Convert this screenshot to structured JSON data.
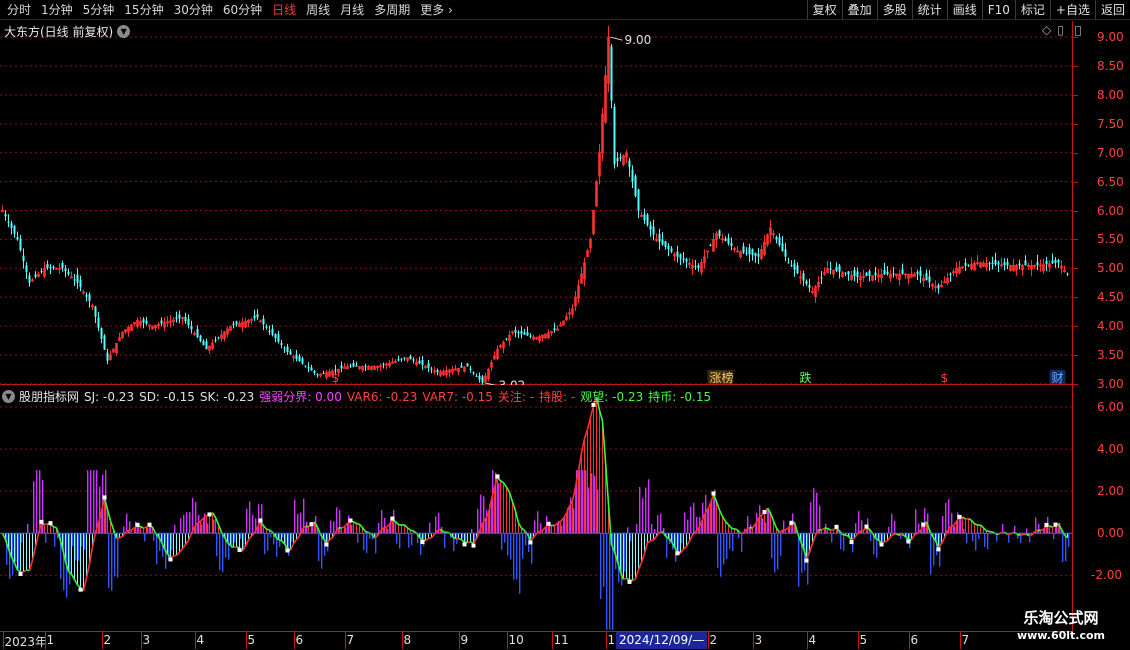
{
  "toolbar": {
    "periods": [
      "分时",
      "1分钟",
      "5分钟",
      "15分钟",
      "30分钟",
      "60分钟",
      "日线",
      "周线",
      "月线",
      "多周期",
      "更多"
    ],
    "active_period": "日线",
    "tools": [
      "复权",
      "叠加",
      "多股",
      "统计",
      "画线",
      "F10",
      "标记",
      "+自选",
      "返回"
    ]
  },
  "main_chart": {
    "title": "大东方(日线 前复权)",
    "corner_icons": [
      "diamond-icon",
      "square-icon"
    ],
    "high_label": "9.00",
    "low_label": "3.02",
    "y_ticks": [
      9.0,
      8.5,
      8.0,
      7.5,
      7.0,
      6.5,
      6.0,
      5.5,
      5.0,
      4.5,
      4.0,
      3.5,
      3.0
    ],
    "y_range": [
      2.98,
      9.28
    ],
    "colors": {
      "up": "#ff3030",
      "down": "#54ffff",
      "grid": "#8b1010"
    },
    "markers": [
      {
        "id": "dollar-1",
        "text": "$",
        "color": "#ff4040",
        "slot": 113
      },
      {
        "id": "zhangbang",
        "text": "涨榜",
        "color": "#ffcc66",
        "slot": 239
      },
      {
        "id": "die",
        "text": "跌",
        "color": "#66ff66",
        "slot": 269
      },
      {
        "id": "dollar-2",
        "text": "$",
        "color": "#ff4040",
        "slot": 316
      },
      {
        "id": "cai",
        "text": "财",
        "color": "#66aaff",
        "slot": 353
      }
    ]
  },
  "indicator": {
    "name": "股朋指标网",
    "values": [
      {
        "label": "SJ: -0.23",
        "color": "#e0e0e0"
      },
      {
        "label": "SD: -0.15",
        "color": "#e0e0e0"
      },
      {
        "label": "SK: -0.23",
        "color": "#e0e0e0"
      },
      {
        "label": "强弱分界: 0.00",
        "color": "#ff44ff"
      },
      {
        "label": "VAR6: -0.23",
        "color": "#ff4040"
      },
      {
        "label": "VAR7: -0.15",
        "color": "#ff4040"
      },
      {
        "label": "关注: -",
        "color": "#ff4040"
      },
      {
        "label": "持股: -",
        "color": "#ff4040"
      },
      {
        "label": "观望: -0.23",
        "color": "#44ff44"
      },
      {
        "label": "持币: -0.15",
        "color": "#44ff44"
      }
    ],
    "y_ticks": [
      6.0,
      4.0,
      2.0,
      0.0,
      -2.0
    ],
    "y_range": [
      -4.6,
      7.0
    ]
  },
  "date_axis": {
    "labels": [
      {
        "text": "2023年",
        "slot": 0
      },
      {
        "text": "1",
        "slot": 14
      },
      {
        "text": "2",
        "slot": 33
      },
      {
        "text": "3",
        "slot": 46
      },
      {
        "text": "4",
        "slot": 64
      },
      {
        "text": "5",
        "slot": 81
      },
      {
        "text": "6",
        "slot": 97
      },
      {
        "text": "7",
        "slot": 114
      },
      {
        "text": "8",
        "slot": 133
      },
      {
        "text": "9",
        "slot": 152
      },
      {
        "text": "10",
        "slot": 168
      },
      {
        "text": "11",
        "slot": 183
      },
      {
        "text": "12",
        "slot": 201
      },
      {
        "text": "2",
        "slot": 235
      },
      {
        "text": "3",
        "slot": 250
      },
      {
        "text": "4",
        "slot": 268
      },
      {
        "text": "5",
        "slot": 285
      },
      {
        "text": "6",
        "slot": 302
      },
      {
        "text": "7",
        "slot": 319
      }
    ],
    "cursor_date": "2024/12/09/—"
  },
  "watermark": {
    "title": "乐淘公式网",
    "url": "www.60lt.com"
  },
  "chart_data": {
    "type": "candlestick",
    "price_anchors": [
      [
        0,
        6.0
      ],
      [
        5,
        5.5
      ],
      [
        9,
        4.75
      ],
      [
        14,
        5.0
      ],
      [
        20,
        5.0
      ],
      [
        25,
        4.75
      ],
      [
        30,
        4.35
      ],
      [
        35,
        3.4
      ],
      [
        40,
        3.9
      ],
      [
        45,
        4.1
      ],
      [
        50,
        4.0
      ],
      [
        60,
        4.15
      ],
      [
        68,
        3.6
      ],
      [
        76,
        4.0
      ],
      [
        85,
        4.15
      ],
      [
        95,
        3.55
      ],
      [
        105,
        3.15
      ],
      [
        115,
        3.3
      ],
      [
        125,
        3.3
      ],
      [
        135,
        3.45
      ],
      [
        145,
        3.2
      ],
      [
        155,
        3.3
      ],
      [
        160,
        3.02
      ],
      [
        165,
        3.6
      ],
      [
        170,
        3.9
      ],
      [
        178,
        3.8
      ],
      [
        185,
        3.95
      ],
      [
        190,
        4.3
      ],
      [
        196,
        5.5
      ],
      [
        199,
        7.0
      ],
      [
        202,
        9.0
      ],
      [
        204,
        6.8
      ],
      [
        208,
        7.0
      ],
      [
        212,
        6.0
      ],
      [
        218,
        5.5
      ],
      [
        225,
        5.2
      ],
      [
        232,
        5.0
      ],
      [
        238,
        5.6
      ],
      [
        245,
        5.3
      ],
      [
        252,
        5.2
      ],
      [
        256,
        5.7
      ],
      [
        262,
        5.1
      ],
      [
        270,
        4.6
      ],
      [
        275,
        5.0
      ],
      [
        285,
        4.85
      ],
      [
        295,
        4.9
      ],
      [
        305,
        4.9
      ],
      [
        312,
        4.65
      ],
      [
        318,
        5.0
      ],
      [
        325,
        5.1
      ],
      [
        335,
        5.05
      ],
      [
        345,
        5.05
      ],
      [
        352,
        5.1
      ],
      [
        355,
        4.9
      ]
    ],
    "indicator_anchors": [
      [
        0,
        0.0
      ],
      [
        5,
        -1.8
      ],
      [
        9,
        -1.8
      ],
      [
        13,
        0.5
      ],
      [
        18,
        0.3
      ],
      [
        22,
        -1.8
      ],
      [
        27,
        -2.8
      ],
      [
        31,
        0.0
      ],
      [
        34,
        1.6
      ],
      [
        38,
        -0.3
      ],
      [
        44,
        0.3
      ],
      [
        50,
        0.3
      ],
      [
        56,
        -1.2
      ],
      [
        60,
        -0.8
      ],
      [
        65,
        0.5
      ],
      [
        70,
        1.0
      ],
      [
        75,
        -0.5
      ],
      [
        80,
        -0.8
      ],
      [
        86,
        0.5
      ],
      [
        90,
        0.0
      ],
      [
        96,
        -0.8
      ],
      [
        100,
        0.2
      ],
      [
        104,
        0.5
      ],
      [
        108,
        -0.5
      ],
      [
        112,
        0.2
      ],
      [
        117,
        0.6
      ],
      [
        124,
        -0.2
      ],
      [
        130,
        0.6
      ],
      [
        136,
        0.2
      ],
      [
        141,
        -0.4
      ],
      [
        146,
        0.2
      ],
      [
        152,
        -0.3
      ],
      [
        157,
        -0.5
      ],
      [
        162,
        1.0
      ],
      [
        165,
        2.7
      ],
      [
        169,
        2.0
      ],
      [
        172,
        0.5
      ],
      [
        176,
        -0.3
      ],
      [
        181,
        0.3
      ],
      [
        186,
        0.5
      ],
      [
        190,
        1.5
      ],
      [
        194,
        4.5
      ],
      [
        198,
        6.5
      ],
      [
        200,
        5.3
      ],
      [
        203,
        -0.5
      ],
      [
        207,
        -2.2
      ],
      [
        211,
        -2.2
      ],
      [
        215,
        -0.5
      ],
      [
        220,
        0.1
      ],
      [
        226,
        -1.0
      ],
      [
        233,
        0.5
      ],
      [
        237,
        1.8
      ],
      [
        241,
        0.5
      ],
      [
        246,
        0.0
      ],
      [
        250,
        0.3
      ],
      [
        255,
        1.2
      ],
      [
        259,
        0.0
      ],
      [
        264,
        0.5
      ],
      [
        268,
        -1.2
      ],
      [
        272,
        0.2
      ],
      [
        278,
        0.2
      ],
      [
        283,
        -0.3
      ],
      [
        288,
        0.3
      ],
      [
        293,
        -0.5
      ],
      [
        298,
        0.0
      ],
      [
        303,
        -0.3
      ],
      [
        308,
        0.5
      ],
      [
        312,
        -0.7
      ],
      [
        316,
        0.3
      ],
      [
        320,
        0.8
      ],
      [
        324,
        0.5
      ],
      [
        330,
        0.0
      ],
      [
        336,
        0.0
      ],
      [
        342,
        -0.1
      ],
      [
        348,
        0.3
      ],
      [
        352,
        0.4
      ],
      [
        355,
        -0.23
      ]
    ]
  }
}
